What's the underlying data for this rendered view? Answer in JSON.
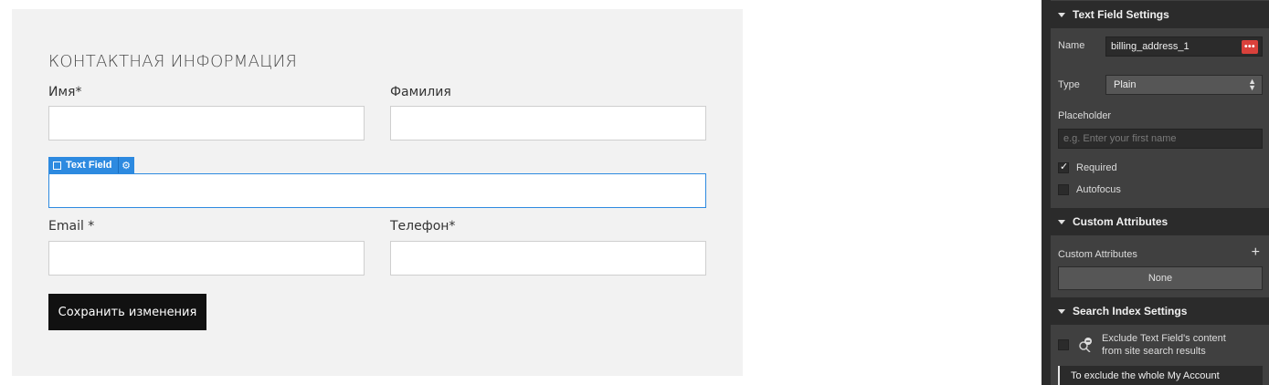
{
  "form": {
    "title": "КОНТАКТНАЯ ИНФОРМАЦИЯ",
    "first_name_label": "Имя*",
    "last_name_label": "Фамилия",
    "email_label": "Email *",
    "phone_label": "Телефон*",
    "save_label": "Сохранить изменения",
    "selection_tag_label": "Text Field"
  },
  "panel": {
    "text_field_settings_title": "Text Field Settings",
    "name_label": "Name",
    "name_value": "billing_address_1",
    "name_dots": "•••",
    "type_label": "Type",
    "type_value": "Plain",
    "placeholder_label": "Placeholder",
    "placeholder_hint": "e.g. Enter your first name",
    "required_label": "Required",
    "required_checked": true,
    "autofocus_label": "Autofocus",
    "autofocus_checked": false,
    "custom_attributes_title": "Custom Attributes",
    "custom_attributes_label": "Custom Attributes",
    "custom_attributes_value": "None",
    "search_index_title": "Search Index Settings",
    "exclude_label_line1": "Exclude Text Field's content",
    "exclude_label_line2": "from site search results",
    "info_text": "To exclude the whole My Account"
  },
  "colors": {
    "accent": "#2d8ae0",
    "panel_bg": "#404040",
    "panel_header_bg": "#2b2b2b",
    "danger": "#d9413b",
    "button_bg": "#111111"
  },
  "icons": {
    "section_caret": "caret-down-icon",
    "gear": "gear-icon",
    "more": "more-dots-icon",
    "plus": "plus-icon",
    "exclude": "search-exclude-icon",
    "check": "check-icon"
  }
}
